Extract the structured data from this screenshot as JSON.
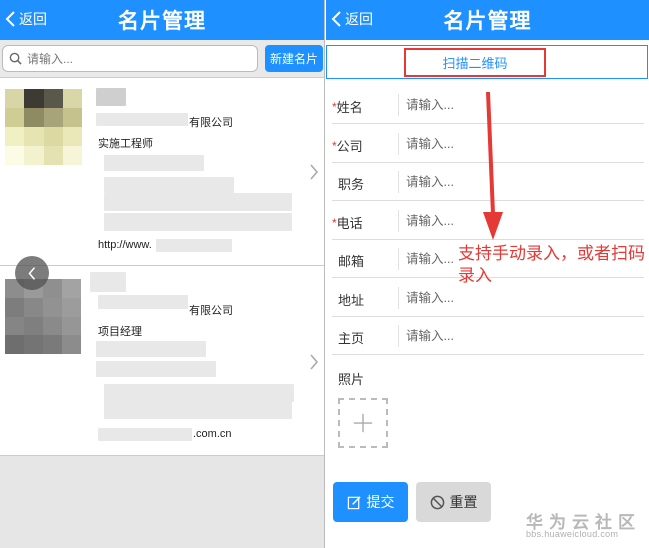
{
  "left": {
    "header": {
      "back_label": "返回",
      "title": "名片管理"
    },
    "search": {
      "placeholder": "请输入..."
    },
    "new_card_label": "新建名片",
    "cards": [
      {
        "company_suffix": "有限公司",
        "job_title": "实施工程师",
        "website": "http://www."
      },
      {
        "company_suffix": "有限公司",
        "job_title": "项目经理",
        "website": ".com.cn"
      }
    ]
  },
  "right": {
    "header": {
      "back_label": "返回",
      "title": "名片管理"
    },
    "scan_label": "扫描二维码",
    "form_fields": [
      {
        "label": "姓名",
        "required": "*",
        "placeholder": "请输入..."
      },
      {
        "label": "公司",
        "required": "*",
        "placeholder": "请输入..."
      },
      {
        "label": "职务",
        "required": "",
        "placeholder": "请输入..."
      },
      {
        "label": "电话",
        "required": "*",
        "placeholder": "请输入..."
      },
      {
        "label": "邮箱",
        "required": "",
        "placeholder": "请输入..."
      },
      {
        "label": "地址",
        "required": "",
        "placeholder": "请输入..."
      },
      {
        "label": "主页",
        "required": "",
        "placeholder": "请输入..."
      }
    ],
    "photo_label": "照片",
    "submit_label": "提交",
    "reset_label": "重置"
  },
  "annotation": {
    "text": "支持手动录入，或者扫码录入",
    "color": "#e53935"
  },
  "watermark": {
    "title": "华为云社区",
    "url": "bbs.huaweicloud.com"
  },
  "colors": {
    "accent": "#1E90FF",
    "required": "#e53935",
    "highlight_border": "#e53935"
  },
  "icons": [
    "chevron-left-icon",
    "search-icon",
    "chevron-right-icon",
    "plus-icon",
    "edit-icon",
    "block-icon"
  ]
}
